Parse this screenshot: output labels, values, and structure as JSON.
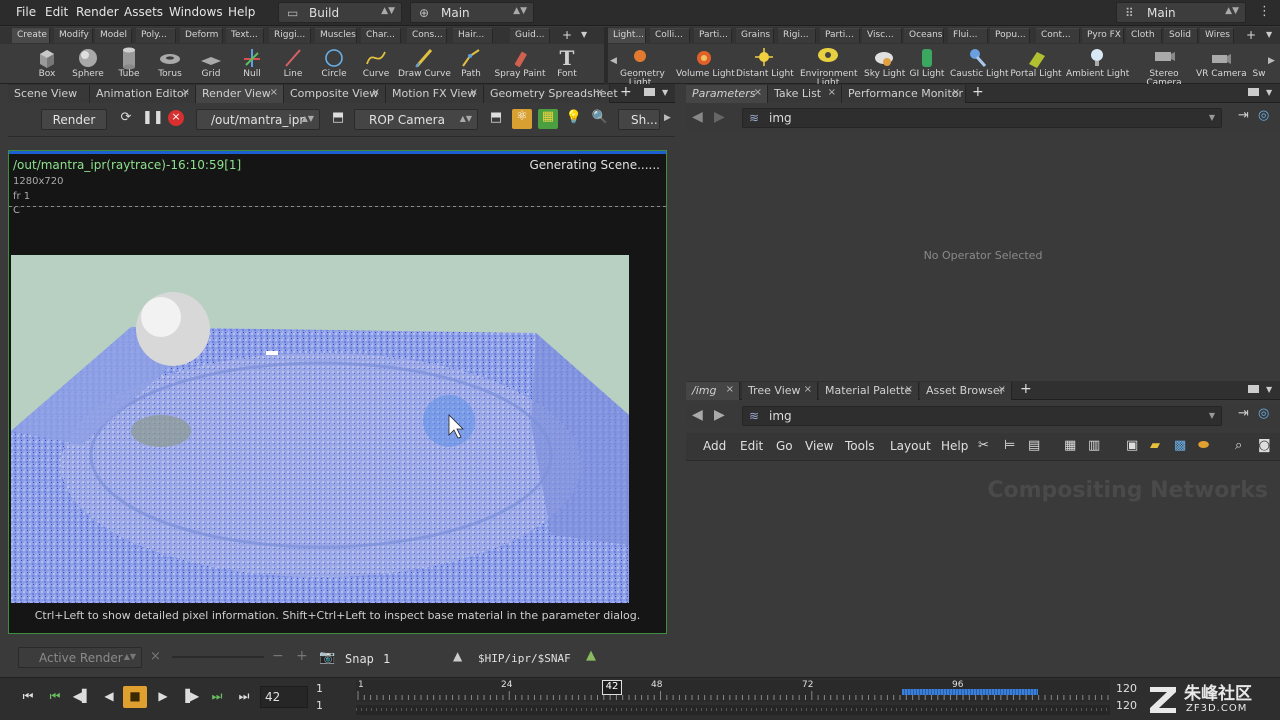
{
  "menubar": {
    "items": [
      "File",
      "Edit",
      "Render",
      "Assets",
      "Windows",
      "Help"
    ],
    "desktop_build": "Build",
    "desktop_main": "Main",
    "right_main": "Main"
  },
  "shelf": {
    "left_tabs": [
      "Create",
      "Modify",
      "Model",
      "Poly...",
      "Deform",
      "Text...",
      "Riggi...",
      "Muscles",
      "Char...",
      "Cons...",
      "Hair...",
      "Guid..."
    ],
    "left_tools": [
      "Box",
      "Sphere",
      "Tube",
      "Torus",
      "Grid",
      "Null",
      "Line",
      "Circle",
      "Curve",
      "Draw Curve",
      "Path",
      "Spray Paint",
      "Font"
    ],
    "right_tabs": [
      "Light...",
      "Colli...",
      "Parti...",
      "Grains",
      "Rigi...",
      "Parti...",
      "Visc...",
      "Oceans",
      "Flui...",
      "Popu...",
      "Cont...",
      "Pyro FX",
      "Cloth",
      "Solid",
      "Wires"
    ],
    "right_tools": [
      "Geometry Light",
      "Volume Light",
      "Distant Light",
      "Environment Light",
      "Sky Light",
      "GI Light",
      "Caustic Light",
      "Portal Light",
      "Ambient Light",
      "Stereo Camera",
      "VR Camera",
      "Sw"
    ]
  },
  "viewer": {
    "tabs": [
      "Scene View",
      "Animation Editor",
      "Render View",
      "Composite View",
      "Motion FX View",
      "Geometry Spreadsheet"
    ],
    "render_button": "Render",
    "rop_path": "/out/mantra_ipr",
    "camera": "ROP Camera",
    "snapshot_btn": "Sh...",
    "render_title": "/out/mantra_ipr(raytrace)-16:10:59[1]",
    "status": "Generating Scene......",
    "resolution": "1280x720",
    "frame": "fr 1",
    "channel": "C",
    "hint": "Ctrl+Left to show detailed pixel information. Shift+Ctrl+Left to inspect base material in the parameter dialog.",
    "active_render": "Active Render",
    "snap_label": "Snap",
    "snap_value": "1",
    "snap_path": "$HIP/ipr/$SNAF"
  },
  "params": {
    "tabs": [
      "Parameters",
      "Take List",
      "Performance Monitor"
    ],
    "path": "img",
    "empty_msg": "No Operator Selected"
  },
  "network": {
    "tabs": [
      "/img",
      "Tree View",
      "Material Palette",
      "Asset Browser"
    ],
    "path": "img",
    "menu": [
      "Add",
      "Edit",
      "Go",
      "View",
      "Tools",
      "Layout",
      "Help"
    ],
    "watermark": "Compositing Networks"
  },
  "timeline": {
    "current_frame": "42",
    "start_top": "1",
    "start_bottom": "1",
    "ticks": [
      "1",
      "24",
      "48",
      "72",
      "96"
    ],
    "end_top": "120",
    "end_bottom": "120",
    "cursor_label": "42",
    "rendered_fraction": 0.27
  },
  "logo": {
    "text": "朱峰社区",
    "sub": "ZF3D.COM"
  },
  "colors": {
    "accent_green": "#3e8e3e",
    "title_green": "#8ee08e",
    "timeline_blue": "#3a7fd8",
    "stop_orange": "#e0a030"
  }
}
